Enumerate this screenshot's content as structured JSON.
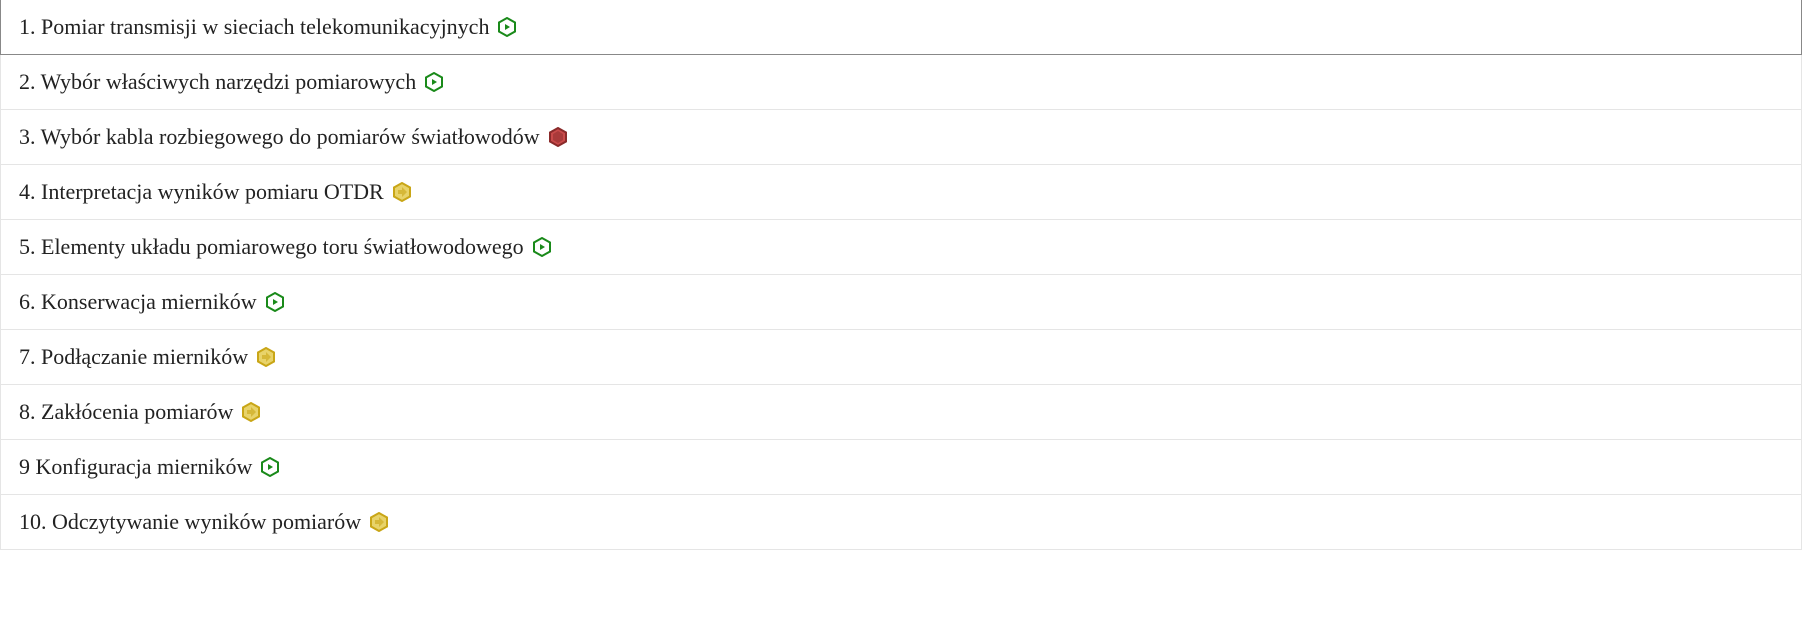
{
  "items": [
    {
      "label": "1. Pomiar transmisji w sieciach telekomunikacyjnych",
      "status": "green",
      "selected": true
    },
    {
      "label": "2. Wybór właściwych narzędzi pomiarowych",
      "status": "green",
      "selected": false
    },
    {
      "label": "3. Wybór kabla rozbiegowego do pomiarów światłowodów",
      "status": "red",
      "selected": false
    },
    {
      "label": "4. Interpretacja wyników pomiaru OTDR",
      "status": "yellow",
      "selected": false
    },
    {
      "label": "5. Elementy układu pomiarowego toru światłowodowego",
      "status": "green",
      "selected": false
    },
    {
      "label": "6. Konserwacja mierników",
      "status": "green",
      "selected": false
    },
    {
      "label": "7. Podłączanie mierników",
      "status": "yellow",
      "selected": false
    },
    {
      "label": "8. Zakłócenia pomiarów",
      "status": "yellow",
      "selected": false
    },
    {
      "label": "9 Konfiguracja mierników",
      "status": "green",
      "selected": false
    },
    {
      "label": "10. Odczytywanie wyników pomiarów",
      "status": "yellow",
      "selected": false
    }
  ],
  "status_colors": {
    "green": {
      "stroke": "#1a8a1a",
      "fill": "#ffffff"
    },
    "yellow": {
      "stroke": "#c9a617",
      "fill": "#e8d36a"
    },
    "red": {
      "stroke": "#8a2a2a",
      "fill": "#c94a4a"
    }
  }
}
